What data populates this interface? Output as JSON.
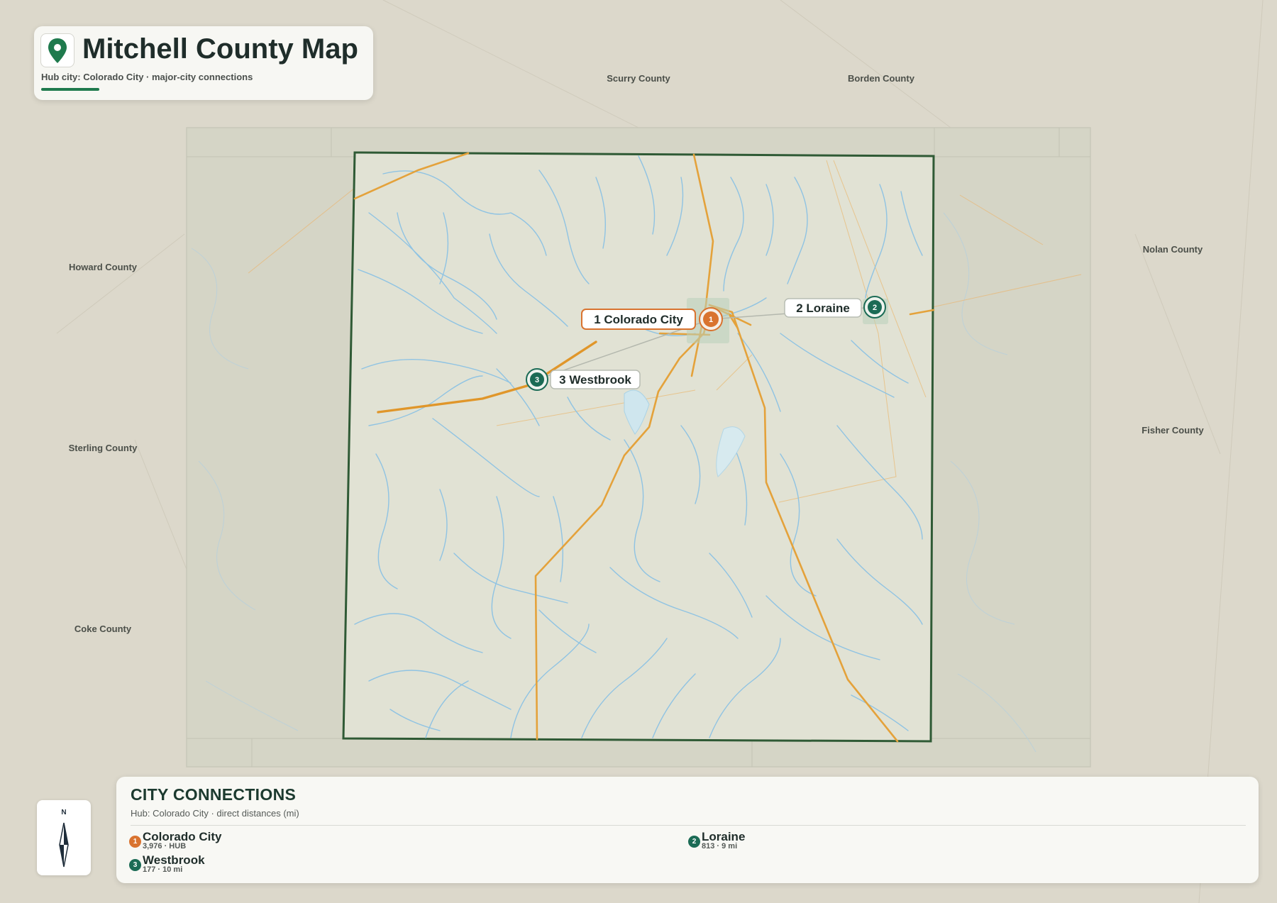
{
  "title": "Mitchell County Map",
  "subtitle": "Hub city: Colorado City · major-city connections",
  "context_counties": [
    {
      "name": "Scurry County"
    },
    {
      "name": "Borden County"
    },
    {
      "name": "Howard County"
    },
    {
      "name": "Nolan County"
    },
    {
      "name": "Sterling County"
    },
    {
      "name": "Fisher County"
    },
    {
      "name": "Coke County"
    }
  ],
  "cities": [
    {
      "num": "1",
      "label": "1 Colorado City",
      "name": "Colorado City",
      "meta": "3,976 · HUB",
      "role": "hub"
    },
    {
      "num": "2",
      "label": "2 Loraine",
      "name": "Loraine",
      "meta": "813 · 9 mi",
      "role": "city"
    },
    {
      "num": "3",
      "label": "3 Westbrook",
      "name": "Westbrook",
      "meta": "177 · 10 mi",
      "role": "city"
    }
  ],
  "compass": {
    "label": "N"
  },
  "legend": {
    "title": "CITY CONNECTIONS",
    "subtitle": "Hub: Colorado City · direct distances (mi)"
  },
  "colors": {
    "hub": "#d9732f",
    "city": "#1b6b55",
    "county_border": "#2f5a35",
    "roads": "#e4a23b",
    "water": "#8fc3e3",
    "background": "#dcd8cb"
  },
  "icons": {
    "title": "map-pin-icon",
    "compass": "compass-needle-icon"
  }
}
